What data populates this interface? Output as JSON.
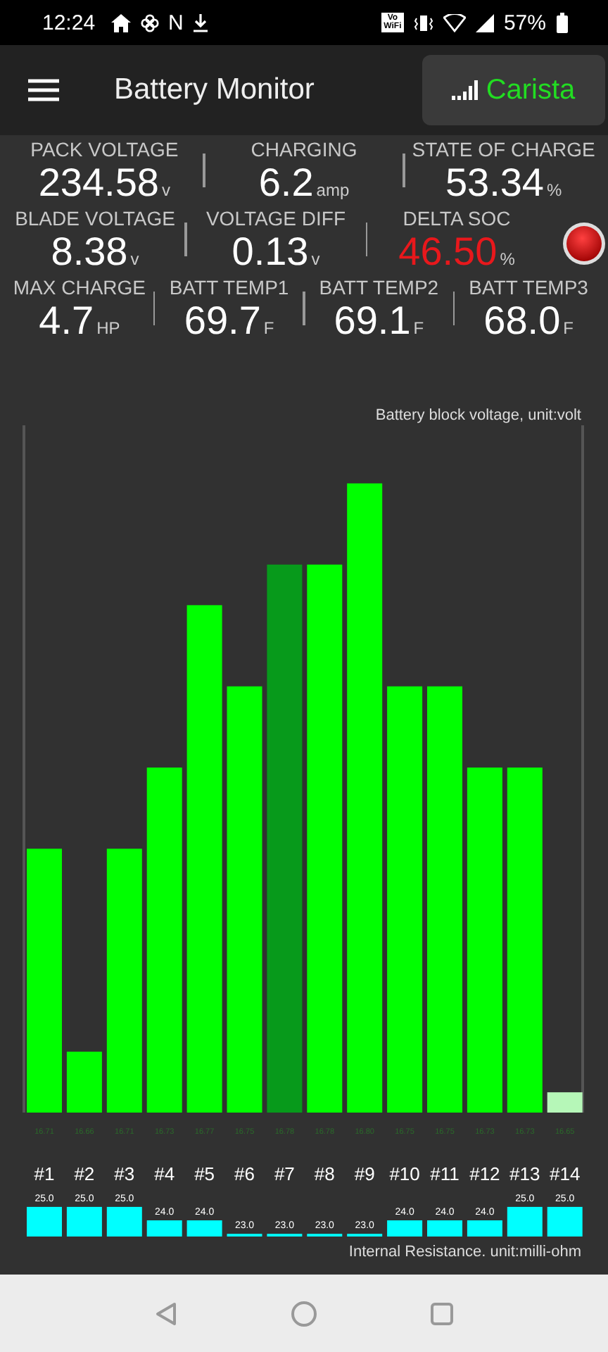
{
  "status_bar": {
    "time": "12:24",
    "notification_letter": "N",
    "vowifi": "Vo WiFi",
    "battery": "57%"
  },
  "app_bar": {
    "title": "Battery Monitor",
    "device": "Carista"
  },
  "metric_rows": [
    {
      "metrics": [
        {
          "label": "PACK VOLTAGE",
          "value": "234.58",
          "unit": "v",
          "warning": false
        },
        {
          "label": "CHARGING",
          "value": "6.2",
          "unit": "amp",
          "warning": false
        },
        {
          "label": "STATE OF CHARGE",
          "value": "53.34",
          "unit": "%",
          "warning": false
        }
      ],
      "alarm": false
    },
    {
      "metrics": [
        {
          "label": "BLADE VOLTAGE",
          "value": "8.38",
          "unit": "v",
          "warning": false
        },
        {
          "label": "VOLTAGE DIFF",
          "value": "0.13",
          "unit": "v",
          "warning": false
        },
        {
          "label": "DELTA SOC",
          "value": "46.50",
          "unit": "%",
          "warning": true
        }
      ],
      "alarm": true
    },
    {
      "metrics": [
        {
          "label": "MAX CHARGE",
          "value": "4.7",
          "unit": "HP",
          "warning": false
        },
        {
          "label": "BATT TEMP1",
          "value": "69.7",
          "unit": "F",
          "warning": false
        },
        {
          "label": "BATT TEMP2",
          "value": "69.1",
          "unit": "F",
          "warning": false
        },
        {
          "label": "BATT TEMP3",
          "value": "68.0",
          "unit": "F",
          "warning": false
        }
      ],
      "alarm": false
    }
  ],
  "voltage_chart": {
    "chart_data": {
      "type": "bar",
      "title": "Battery block voltage, unit:volt",
      "categories": [
        "#1",
        "#2",
        "#3",
        "#4",
        "#5",
        "#6",
        "#7",
        "#8",
        "#9",
        "#10",
        "#11",
        "#12",
        "#13",
        "#14"
      ],
      "series": [
        {
          "color": "#00ff00",
          "values": [
            16.71,
            16.66,
            16.71,
            16.73,
            16.77,
            16.75,
            null,
            16.78,
            16.8,
            16.75,
            16.75,
            16.73,
            16.73,
            null
          ],
          "value_labels": [
            "16.71",
            "16.66",
            "16.71",
            "16.73",
            "16.77",
            "16.75",
            null,
            "16.78",
            "16.80",
            "16.75",
            "16.75",
            "16.73",
            "16.73",
            null
          ]
        },
        {
          "color": "#079a1b",
          "values": [
            null,
            null,
            null,
            null,
            null,
            null,
            16.78,
            null,
            null,
            null,
            null,
            null,
            null,
            null
          ],
          "value_labels": [
            null,
            null,
            null,
            null,
            null,
            null,
            "16.78",
            null,
            null,
            null,
            null,
            null,
            null,
            null
          ]
        },
        {
          "color": "#b6f7b8",
          "values": [
            null,
            null,
            null,
            null,
            null,
            null,
            null,
            null,
            null,
            null,
            null,
            null,
            null,
            16.65
          ],
          "value_labels": [
            null,
            null,
            null,
            null,
            null,
            null,
            null,
            null,
            null,
            null,
            null,
            null,
            null,
            "16.65"
          ]
        }
      ],
      "ylim": [
        16.645,
        16.815
      ],
      "data_labels": true
    }
  },
  "resistance_chart": {
    "chart_data": {
      "type": "bar",
      "title": "Internal Resistance. unit:milli-ohm",
      "series": [
        {
          "color": "#00ffff",
          "values": [
            25.0,
            25.0,
            25.0,
            24.0,
            24.0,
            23.0,
            23.0,
            23.0,
            23.0,
            24.0,
            24.0,
            24.0,
            25.0,
            25.0
          ],
          "value_labels": [
            "25.0",
            "25.0",
            "25.0",
            "24.0",
            "24.0",
            "23.0",
            "23.0",
            "23.0",
            "23.0",
            "24.0",
            "24.0",
            "24.0",
            "25.0",
            "25.0"
          ]
        }
      ],
      "ylim": [
        22.8,
        25.1
      ],
      "data_labels": true
    }
  }
}
